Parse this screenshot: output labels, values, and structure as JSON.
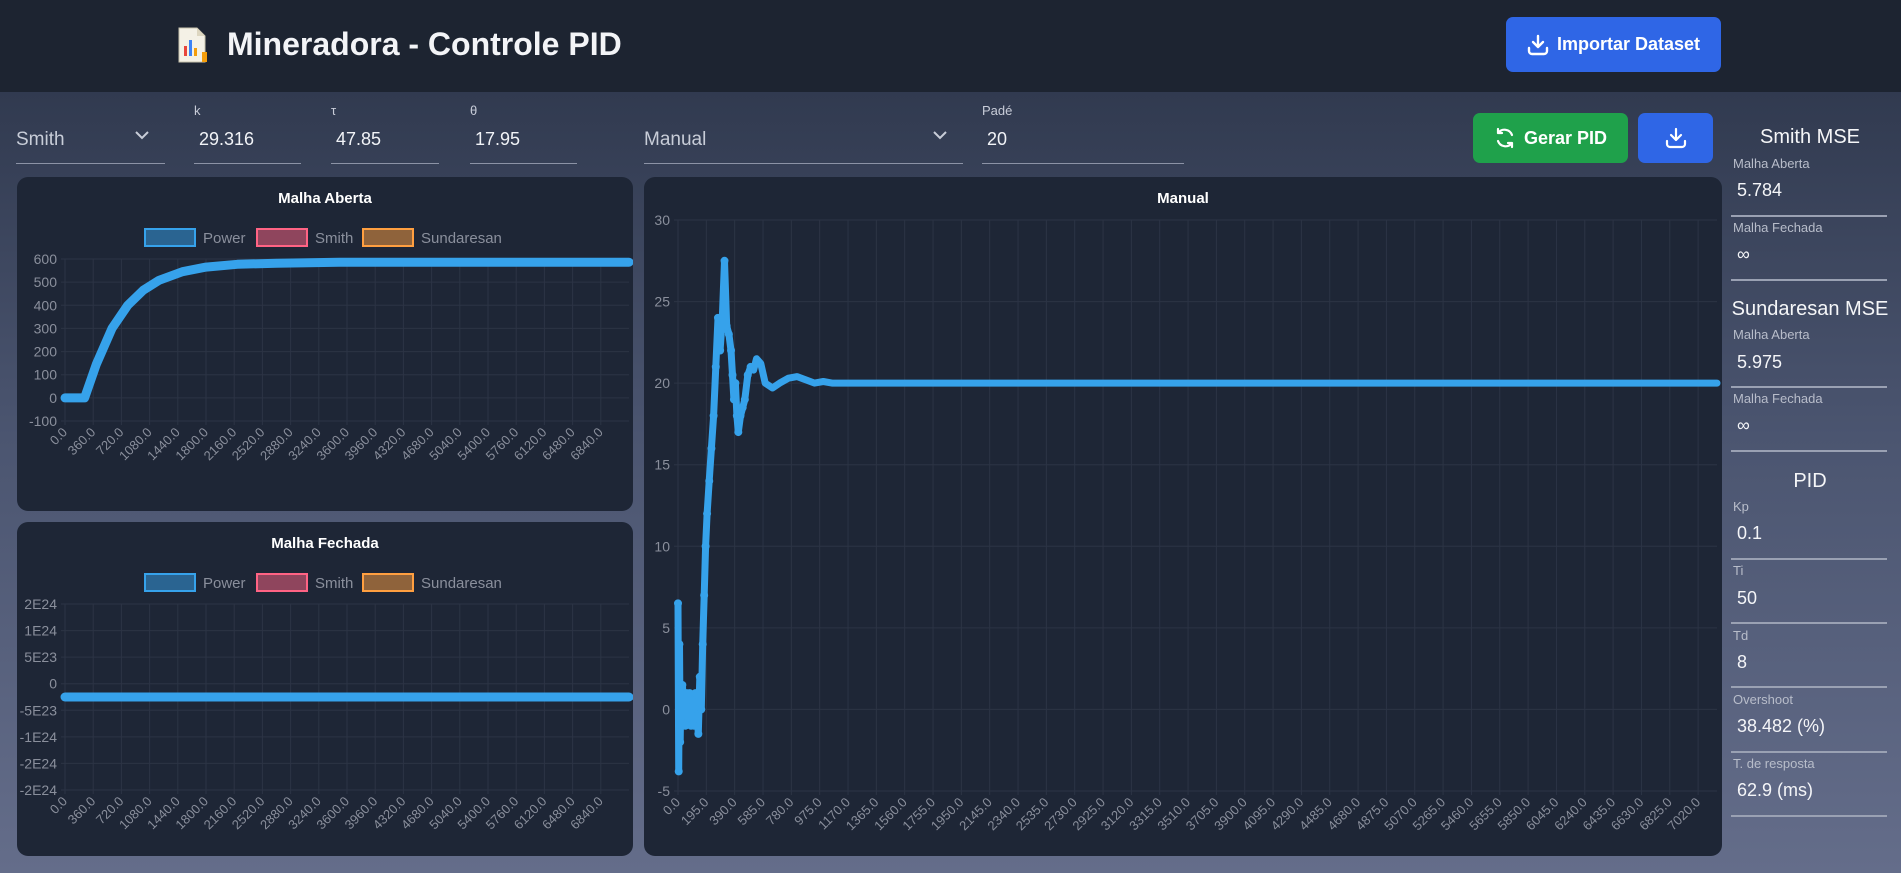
{
  "header": {
    "title": "Mineradora - Controle PID",
    "import_label": "Importar Dataset"
  },
  "controls": {
    "method_select": "Smith",
    "k_label": "k",
    "k_value": "29.316",
    "tau_label": "τ",
    "tau_value": "47.85",
    "theta_label": "θ",
    "theta_value": "17.95",
    "tuning_select": "Manual",
    "pade_label": "Padé",
    "pade_value": "20",
    "generate_label": "Gerar PID"
  },
  "sidebar": {
    "smith_title": "Smith MSE",
    "smith_open_label": "Malha Aberta",
    "smith_open_value": "5.784",
    "smith_closed_label": "Malha Fechada",
    "smith_closed_value": "∞",
    "sund_title": "Sundaresan MSE",
    "sund_open_label": "Malha Aberta",
    "sund_open_value": "5.975",
    "sund_closed_label": "Malha Fechada",
    "sund_closed_value": "∞",
    "pid_title": "PID",
    "kp_label": "Kp",
    "kp_value": "0.1",
    "ti_label": "Ti",
    "ti_value": "50",
    "td_label": "Td",
    "td_value": "8",
    "overshoot_label": "Overshoot",
    "overshoot_value": "38.482 (%)",
    "response_label": "T. de resposta",
    "response_value": "62.9 (ms)"
  },
  "colors": {
    "power": "#36a2eb",
    "smith": "#ff6384",
    "sundaresan": "#ff9f40",
    "grid": "#2c3445",
    "tick": "#8a8f9c"
  },
  "chart_data": [
    {
      "id": "open",
      "type": "line",
      "title": "Malha Aberta",
      "legend": [
        "Power",
        "Smith",
        "Sundaresan"
      ],
      "legend_position": "top",
      "ylim": [
        -100,
        600
      ],
      "yticks": [
        "600",
        "500",
        "400",
        "300",
        "200",
        "100",
        "0",
        "-100"
      ],
      "xlim": [
        0,
        7200
      ],
      "xticks": [
        "0.0",
        "360.0",
        "720.0",
        "1080.0",
        "1440.0",
        "1800.0",
        "2160.0",
        "2520.0",
        "2880.0",
        "3240.0",
        "3600.0",
        "3960.0",
        "4320.0",
        "4680.0",
        "5040.0",
        "5400.0",
        "5760.0",
        "6120.0",
        "6480.0",
        "6840.0"
      ],
      "series": [
        {
          "name": "Power",
          "x": [
            0,
            240,
            250,
            400,
            600,
            800,
            1000,
            1200,
            1500,
            1800,
            2200,
            2700,
            3500,
            5000,
            7200
          ],
          "values": [
            0,
            0,
            0,
            145,
            300,
            400,
            465,
            508,
            545,
            565,
            577,
            582,
            586,
            586,
            586
          ]
        }
      ]
    },
    {
      "id": "closed",
      "type": "line",
      "title": "Malha Fechada",
      "legend": [
        "Power",
        "Smith",
        "Sundaresan"
      ],
      "legend_position": "top",
      "ylim": [
        -2e+24,
        2e+24
      ],
      "yticks": [
        "2E24",
        "1E24",
        "5E23",
        "0",
        "-5E23",
        "-1E24",
        "-2E24",
        "-2E24"
      ],
      "xlim": [
        0,
        7200
      ],
      "xticks": [
        "0.0",
        "360.0",
        "720.0",
        "1080.0",
        "1440.0",
        "1800.0",
        "2160.0",
        "2520.0",
        "2880.0",
        "3240.0",
        "3600.0",
        "3960.0",
        "4320.0",
        "4680.0",
        "5040.0",
        "5400.0",
        "5760.0",
        "6120.0",
        "6480.0",
        "6840.0"
      ],
      "series": [
        {
          "name": "Smith",
          "x": [
            6200,
            6400,
            6500,
            6600,
            6700,
            6760,
            6800,
            6850,
            6900,
            6950,
            6980,
            7000,
            7020
          ],
          "values": [
            0,
            -0.3,
            0.2,
            0.8,
            -1,
            -2,
            -1.5,
            1,
            3,
            3.3,
            1,
            -2,
            -4.4
          ]
        },
        {
          "name": "Power",
          "x": [
            0,
            7200
          ],
          "values": [
            0,
            0
          ]
        }
      ]
    },
    {
      "id": "manual",
      "type": "line",
      "title": "Manual",
      "ylim": [
        -5,
        30
      ],
      "yticks": [
        "30",
        "25",
        "20",
        "15",
        "10",
        "5",
        "0",
        "-5"
      ],
      "xlim": [
        0,
        7150
      ],
      "xticks": [
        "0.0",
        "195.0",
        "390.0",
        "585.0",
        "780.0",
        "975.0",
        "1170.0",
        "1365.0",
        "1560.0",
        "1755.0",
        "1950.0",
        "2145.0",
        "2340.0",
        "2535.0",
        "2730.0",
        "2925.0",
        "3120.0",
        "3315.0",
        "3510.0",
        "3705.0",
        "3900.0",
        "4095.0",
        "4290.0",
        "4485.0",
        "4680.0",
        "4875.0",
        "5070.0",
        "5265.0",
        "5460.0",
        "5655.0",
        "5850.0",
        "6045.0",
        "6240.0",
        "6435.0",
        "6630.0",
        "6825.0",
        "7020.0"
      ],
      "series": [
        {
          "name": "Power",
          "x": [
            0,
            5,
            10,
            15,
            20,
            25,
            30,
            40,
            50,
            60,
            70,
            80,
            90,
            100,
            110,
            120,
            130,
            140,
            150,
            160,
            170,
            180,
            190,
            200,
            215,
            230,
            245,
            260,
            275,
            290,
            305,
            320,
            335,
            350,
            365,
            375,
            385,
            395,
            405,
            415,
            430,
            445,
            460,
            480,
            500,
            520,
            540,
            570,
            600,
            650,
            700,
            760,
            820,
            880,
            940,
            1000,
            1060,
            1120,
            1180,
            1260,
            1340,
            1420,
            1500,
            1580,
            1700,
            1850,
            2000,
            3000,
            4500,
            7150
          ],
          "values": [
            6.5,
            -3.8,
            4,
            -2,
            1.5,
            -1,
            1.5,
            0,
            -1,
            1,
            -0.5,
            1,
            -1,
            0.5,
            -1,
            1,
            0,
            -1.5,
            2,
            0,
            4,
            7,
            10,
            12,
            14,
            16,
            18,
            21,
            24,
            22,
            24,
            27.5,
            23.5,
            23,
            22,
            20.5,
            19,
            20,
            18,
            17,
            18,
            18.5,
            19,
            20.5,
            21,
            20.8,
            21.5,
            21.2,
            20,
            19.7,
            20,
            20.3,
            20.4,
            20.2,
            20,
            20.1,
            20,
            20,
            20,
            20,
            20,
            20,
            20,
            20,
            20,
            20,
            20,
            20,
            20,
            20
          ]
        }
      ]
    }
  ]
}
